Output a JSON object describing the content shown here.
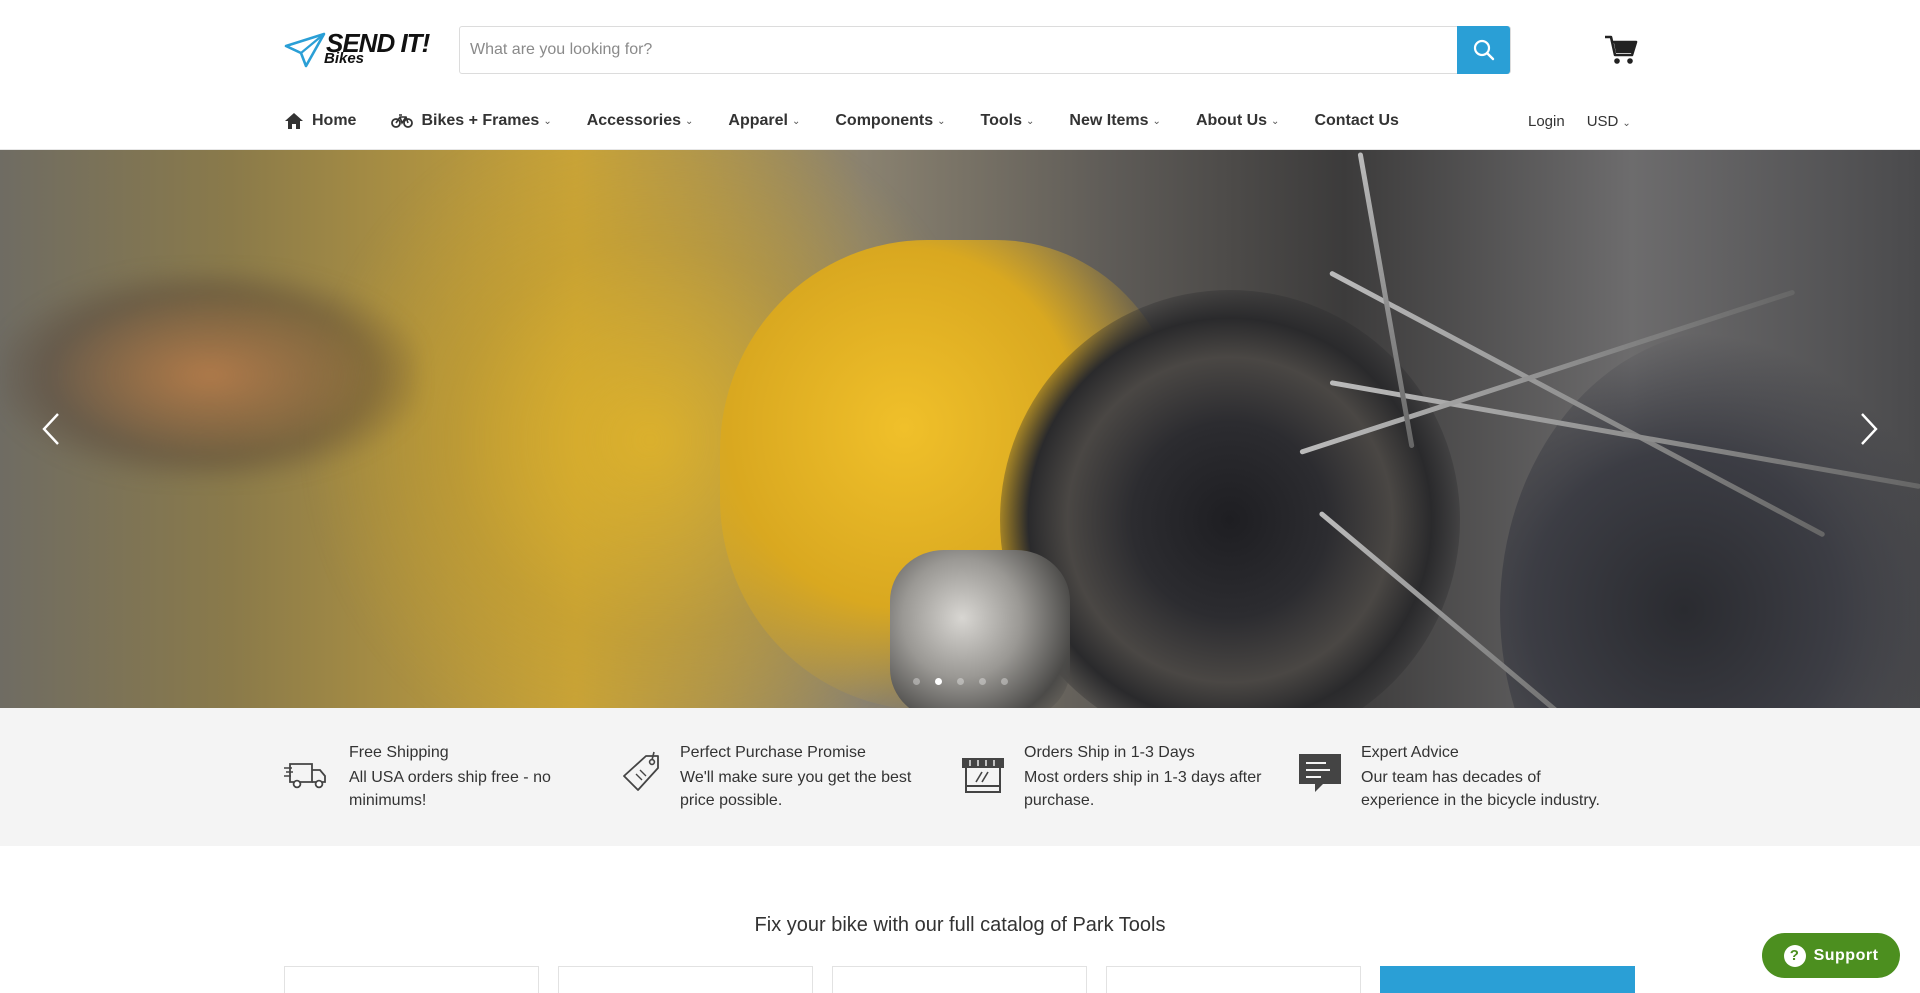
{
  "header": {
    "logo": {
      "brand": "SEND IT!",
      "sub": "Bikes"
    },
    "search": {
      "placeholder": "What are you looking for?",
      "value": ""
    },
    "cart_icon": "cart-icon"
  },
  "nav": {
    "items": [
      {
        "label": "Home",
        "icon": "home-icon",
        "dropdown": false
      },
      {
        "label": "Bikes + Frames",
        "icon": "bike-icon",
        "dropdown": true
      },
      {
        "label": "Accessories",
        "dropdown": true
      },
      {
        "label": "Apparel",
        "dropdown": true
      },
      {
        "label": "Components",
        "dropdown": true
      },
      {
        "label": "Tools",
        "dropdown": true
      },
      {
        "label": "New Items",
        "dropdown": true
      },
      {
        "label": "About Us",
        "dropdown": true
      },
      {
        "label": "Contact Us",
        "dropdown": false
      }
    ],
    "login": "Login",
    "currency": "USD"
  },
  "hero": {
    "slides": 5,
    "active_slide": 2
  },
  "features": [
    {
      "icon": "delivery-truck-icon",
      "title": "Free Shipping",
      "desc": "All USA orders ship free - no minimums!"
    },
    {
      "icon": "price-tag-icon",
      "title": "Perfect Purchase Promise",
      "desc": "We'll make sure you get the best price possible."
    },
    {
      "icon": "storefront-icon",
      "title": "Orders Ship in 1-3 Days",
      "desc": "Most orders ship in 1-3 days after purchase."
    },
    {
      "icon": "chat-bubble-icon",
      "title": "Expert Advice",
      "desc": "Our team has decades of experience in the bicycle industry."
    }
  ],
  "catalog": {
    "title": "Fix your bike with our full catalog of Park Tools"
  },
  "support": {
    "label": "Support"
  },
  "colors": {
    "accent": "#2a9fd6",
    "support_green": "#4c8f1f",
    "features_bg": "#f4f4f4"
  }
}
